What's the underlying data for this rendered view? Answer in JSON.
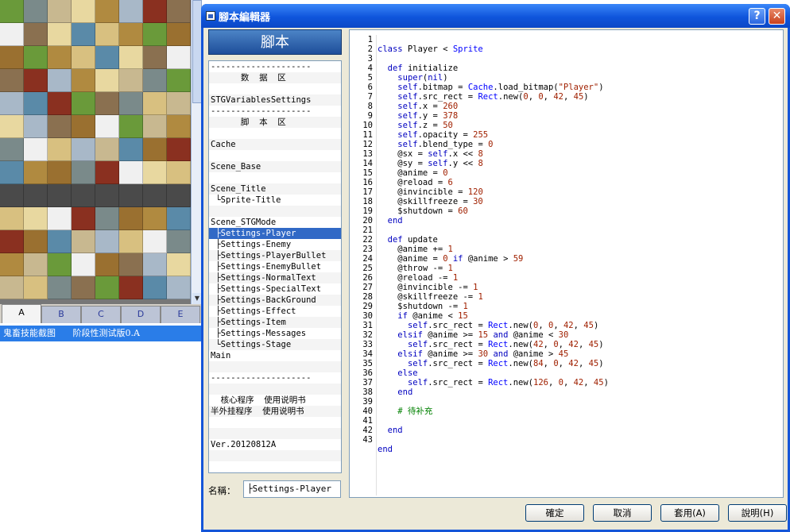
{
  "background": {
    "tabs": [
      "A",
      "B",
      "C",
      "D",
      "E"
    ],
    "status_left": "鬼畜技能截图",
    "status_right": "阶段性测试版0.A",
    "tile_colors": [
      "#6a9a3a",
      "#d8c080",
      "#e8d8a0",
      "#f0f0f0",
      "#8a3020",
      "#7a8a8a",
      "#9a7030",
      "#b08a40",
      "#5a8aa8",
      "#8a7050",
      "#c8b890",
      "#4a4a4a",
      "#a8b8c8"
    ]
  },
  "dialog": {
    "title": "腳本編輯器",
    "help_label": "?",
    "close_label": "✕",
    "side_header": "腳本",
    "list_items": [
      "--------------------",
      "      数  据  区",
      "",
      "STGVariablesSettings",
      "--------------------",
      "      脚  本  区",
      "",
      "Cache",
      "",
      "Scene_Base",
      "",
      "Scene_Title",
      " └Sprite-Title",
      "",
      "Scene_STGMode",
      " ├Settings-Player",
      " ├Settings-Enemy",
      " ├Settings-PlayerBullet",
      " ├Settings-EnemyBullet",
      " ├Settings-NormalText",
      " ├Settings-SpecialText",
      " ├Settings-BackGround",
      " ├Settings-Effect",
      " ├Settings-Item",
      " ├Settings-Messages",
      " └Settings-Stage",
      "Main",
      "",
      "--------------------",
      "",
      "  核心程序  使用说明书",
      "半外挂程序  使用说明书",
      "",
      "",
      "Ver.20120812A",
      ""
    ],
    "selected_index": 15,
    "name_label": "名稱：",
    "name_value": "├Settings-Player",
    "line_numbers": [
      "1",
      "2",
      "3",
      "4",
      "5",
      "6",
      "7",
      "8",
      "9",
      "10",
      "11",
      "12",
      "13",
      "14",
      "15",
      "16",
      "17",
      "18",
      "19",
      "20",
      "21",
      "22",
      "23",
      "24",
      "25",
      "26",
      "27",
      "28",
      "29",
      "30",
      "31",
      "32",
      "33",
      "34",
      "35",
      "36",
      "37",
      "38",
      "39",
      "40",
      "41",
      "42",
      "43"
    ],
    "code_lines": [
      "",
      "class Player < Sprite",
      "",
      "  def initialize",
      "    super(nil)",
      "    self.bitmap = Cache.load_bitmap(\"Player\")",
      "    self.src_rect = Rect.new(0, 0, 42, 45)",
      "    self.x = 260",
      "    self.y = 378",
      "    self.z = 50",
      "    self.opacity = 255",
      "    self.blend_type = 0",
      "    @sx = self.x << 8",
      "    @sy = self.y << 8",
      "    @anime = 0",
      "    @reload = 6",
      "    @invincible = 120",
      "    @skillfreeze = 30",
      "    $shutdown = 60",
      "  end",
      "",
      "  def update",
      "    @anime += 1",
      "    @anime = 0 if @anime > 59",
      "    @throw -= 1",
      "    @reload -= 1",
      "    @invincible -= 1",
      "    @skillfreeze -= 1",
      "    $shutdown -= 1",
      "    if @anime < 15",
      "      self.src_rect = Rect.new(0, 0, 42, 45)",
      "    elsif @anime >= 15 and @anime < 30",
      "      self.src_rect = Rect.new(42, 0, 42, 45)",
      "    elsif @anime >= 30 and @anime > 45",
      "      self.src_rect = Rect.new(84, 0, 42, 45)",
      "    else",
      "      self.src_rect = Rect.new(126, 0, 42, 45)",
      "    end",
      "",
      "    # 待补充",
      "",
      "  end",
      "",
      "end"
    ],
    "buttons": {
      "ok": "確定",
      "cancel": "取消",
      "apply": "套用(A)",
      "help": "說明(H)"
    }
  }
}
